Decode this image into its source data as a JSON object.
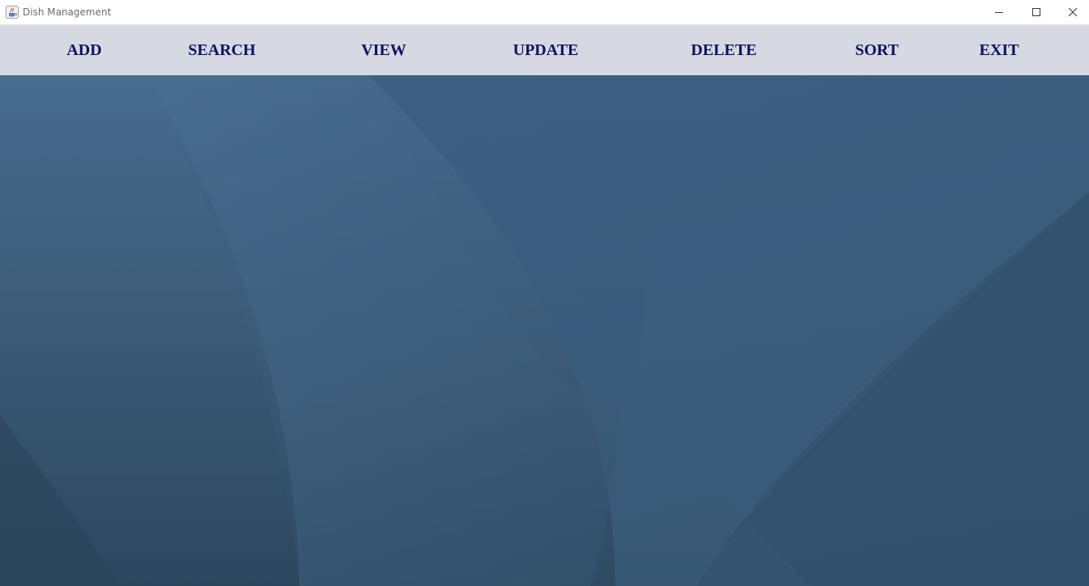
{
  "window": {
    "title": "Dish Management",
    "icon": "java-cup-icon"
  },
  "controls": {
    "minimize_icon": "minimize-icon",
    "maximize_icon": "maximize-icon",
    "close_icon": "close-icon"
  },
  "menu": {
    "items": [
      {
        "label": "ADD"
      },
      {
        "label": "SEARCH"
      },
      {
        "label": "VIEW"
      },
      {
        "label": "UPDATE"
      },
      {
        "label": "DELETE"
      },
      {
        "label": "SORT"
      },
      {
        "label": "EXIT"
      }
    ]
  },
  "colors": {
    "menu_background": "#d6d9e1",
    "menu_text": "#0f1260",
    "wallpaper_light": "#46698b",
    "wallpaper_dark": "#2d475f"
  }
}
